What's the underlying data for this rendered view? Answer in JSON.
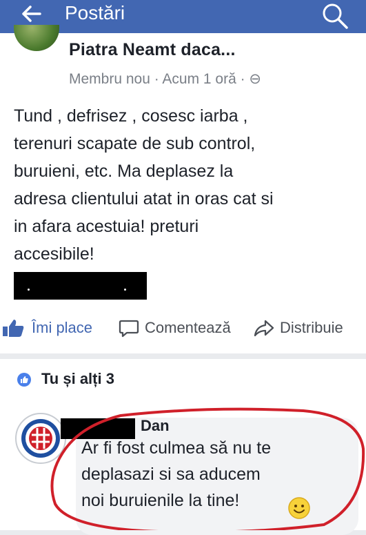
{
  "topbar": {
    "title": "Postări",
    "back_icon": "back-arrow-icon",
    "search_icon": "search-icon",
    "bg_color": "#4267b2"
  },
  "post": {
    "group_name": "Piatra Neamt daca...",
    "meta": "Membru nou · Acum 1 oră · ⊖",
    "text": "Tund , defrisez , cosesc iarba ,\nterenuri scapate de sub control,\nburuieni, etc. Ma deplasez la\nadresa clientului atat in oras cat si\nin afara acestuia! preturi\naccesibile!"
  },
  "actions": {
    "like_label": "Îmi place",
    "comment_label": "Comentează",
    "share_label": "Distribuie"
  },
  "reactions": {
    "text": "Tu și alți 3"
  },
  "comment": {
    "author": "Dan",
    "text": "Ar fi fost culmea să nu te\ndeplasazi si sa aducem\nnoi buruienile la tine!",
    "emoji": "smiley-icon",
    "highlight_color": "#d0202a"
  }
}
